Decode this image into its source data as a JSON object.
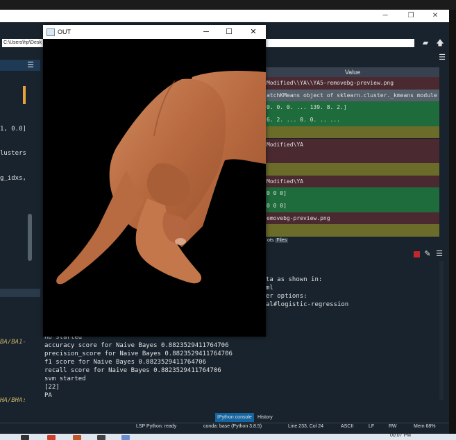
{
  "out_window": {
    "title": "OUT",
    "minimize": "─",
    "maximize": "☐",
    "close": "✕"
  },
  "spyder": {
    "path_text": "C:\\Users\\hp\\Desk",
    "variable_explorer": {
      "value_header": "Value",
      "rows": [
        {
          "value": "Modified\\\\YA\\\\YA5-removebg-preview.png",
          "color": "#4a2a30"
        },
        {
          "value": "atchKMeans object of sklearn.cluster._kmeans module",
          "color": "#55606b"
        },
        {
          "value": "0.   0.   0. ... 139.   8.   2.]",
          "color": "#1e6b3c"
        },
        {
          "value": "6.   2. ...   0.   0. .. ...",
          "color": "#1e6b3c"
        },
        {
          "value": "",
          "color": "#6b6b2a"
        },
        {
          "value": "Modified\\YA",
          "color": "#4a2a30"
        },
        {
          "value": "",
          "color": "#4a2a30"
        },
        {
          "value": "",
          "color": "#6b6b2a"
        },
        {
          "value": "Modified\\YA",
          "color": "#4a2a30"
        },
        {
          "value": "0   0   0]",
          "color": "#1e6b3c"
        },
        {
          "value": "0   0   0]",
          "color": "#1e6b3c"
        },
        {
          "value": "emovebg-preview.png",
          "color": "#4a2a30"
        },
        {
          "value": "",
          "color": "#6b6b2a"
        }
      ],
      "tabs": [
        "ots",
        "Files"
      ]
    },
    "editor_fragments": [
      "1, 0.0]",
      "lusters",
      "g_idxs,",
      "BA/BA1-",
      "HA/BHA:"
    ],
    "console_right": [
      "ta as shown in:",
      "ml",
      "er options:",
      "al#logistic-regression"
    ],
    "console_lines": [
      "nb started",
      "accuracy score for  Naive Bayes 0.8823529411764706",
      "precision_score for  Naive Bayes 0.8823529411764706",
      "f1 score for  Naive Bayes 0.8823529411764706",
      "recall score for  Naive Bayes 0.8823529411764706",
      "svm started",
      "[22]",
      "PA"
    ],
    "console_tabs": [
      "IPython console",
      "History"
    ],
    "status": {
      "lsp": "LSP Python: ready",
      "conda": "conda: base (Python 3.8.5)",
      "position": "Line 233, Col 24",
      "encoding": "ASCII",
      "eol": "LF",
      "permissions": "RW",
      "memory": "Mem 68%"
    },
    "clock": "00:07 PM"
  },
  "colors": {
    "ide_bg": "#19232d",
    "skin": "#c07a52"
  }
}
